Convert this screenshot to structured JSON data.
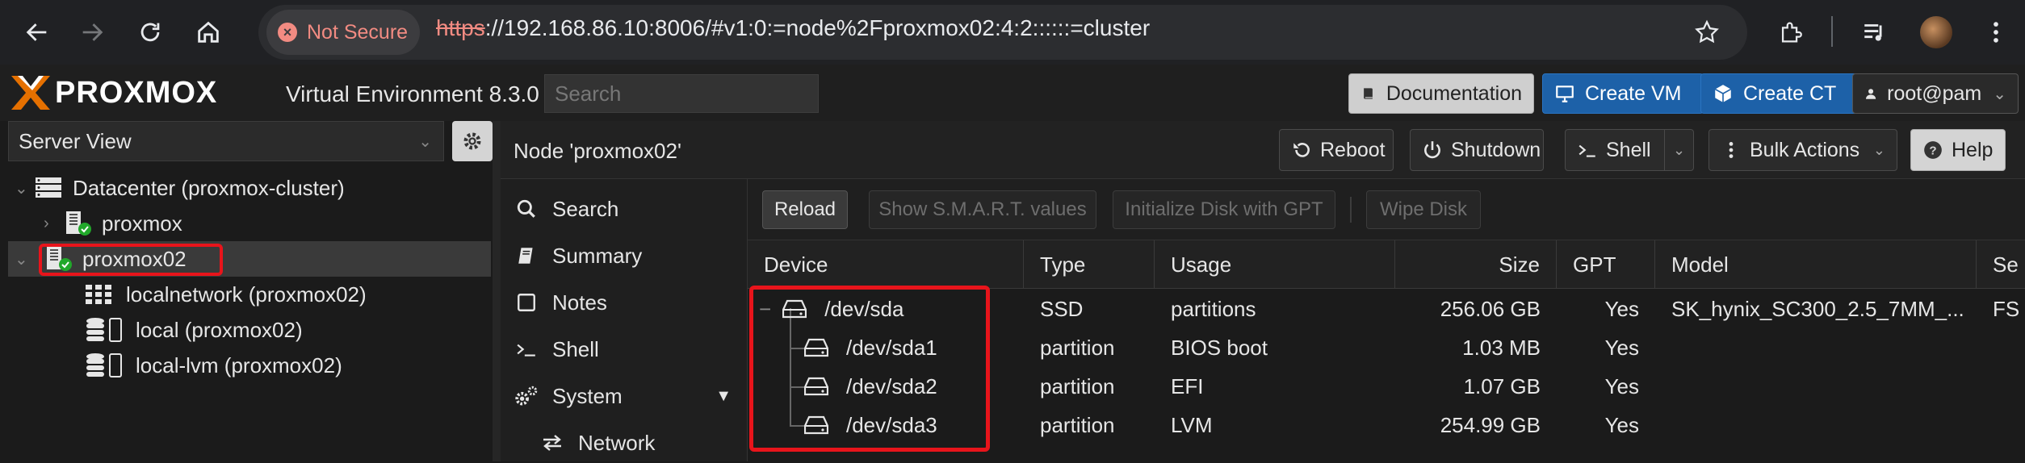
{
  "browser": {
    "security_label": "Not Secure",
    "url_scheme": "https",
    "url_host": "://192.168.86.10",
    "url_rest": ":8006/#v1:0:=node%2Fproxmox02:4:2::::::=cluster"
  },
  "header": {
    "brand": "PROXMOX",
    "product": "Virtual Environment 8.3.0",
    "search_placeholder": "Search",
    "documentation": "Documentation",
    "create_vm": "Create VM",
    "create_ct": "Create CT",
    "user": "root@pam"
  },
  "left": {
    "view": "Server View",
    "tree": [
      {
        "label": "Datacenter (proxmox-cluster)",
        "icon": "datacenter-icon"
      },
      {
        "label": "proxmox",
        "icon": "server-online-icon"
      },
      {
        "label": "proxmox02",
        "icon": "server-online-icon",
        "selected": true
      },
      {
        "label": "localnetwork (proxmox02)",
        "icon": "network-grid-icon"
      },
      {
        "label": "local (proxmox02)",
        "icon": "storage-icon"
      },
      {
        "label": "local-lvm (proxmox02)",
        "icon": "storage-icon"
      }
    ]
  },
  "main": {
    "title": "Node 'proxmox02'",
    "buttons": {
      "reboot": "Reboot",
      "shutdown": "Shutdown",
      "shell": "Shell",
      "bulk": "Bulk Actions",
      "help": "Help"
    },
    "nav": [
      {
        "label": "Search",
        "icon": "search-icon"
      },
      {
        "label": "Summary",
        "icon": "book-icon"
      },
      {
        "label": "Notes",
        "icon": "notes-icon"
      },
      {
        "label": "Shell",
        "icon": "terminal-icon"
      },
      {
        "label": "System",
        "icon": "gears-icon"
      },
      {
        "label": "Network",
        "icon": "exchange-icon"
      }
    ],
    "disk_toolbar": {
      "reload": "Reload",
      "smart": "Show S.M.A.R.T. values",
      "init_gpt": "Initialize Disk with GPT",
      "wipe": "Wipe Disk"
    },
    "columns": [
      "Device",
      "Type",
      "Usage",
      "Size",
      "GPT",
      "Model",
      "Se"
    ],
    "rows": [
      {
        "device": "/dev/sda",
        "type": "SSD",
        "usage": "partitions",
        "size": "256.06 GB",
        "gpt": "Yes",
        "model": "SK_hynix_SC300_2.5_7MM_...",
        "serial": "FS"
      },
      {
        "device": "/dev/sda1",
        "type": "partition",
        "usage": "BIOS boot",
        "size": "1.03 MB",
        "gpt": "Yes",
        "model": "",
        "serial": ""
      },
      {
        "device": "/dev/sda2",
        "type": "partition",
        "usage": "EFI",
        "size": "1.07 GB",
        "gpt": "Yes",
        "model": "",
        "serial": ""
      },
      {
        "device": "/dev/sda3",
        "type": "partition",
        "usage": "LVM",
        "size": "254.99 GB",
        "gpt": "Yes",
        "model": "",
        "serial": ""
      }
    ]
  },
  "colors": {
    "highlight": "#e8141b",
    "brand_orange": "#e57000",
    "primary_button": "#1d61a8"
  }
}
